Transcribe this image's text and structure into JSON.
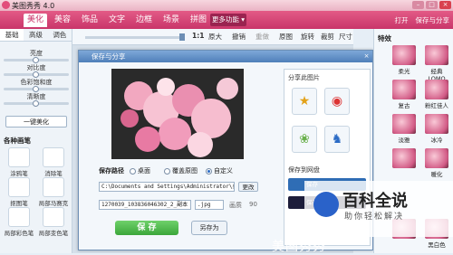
{
  "window": {
    "title": "美图秀秀 4.0"
  },
  "tabs": [
    {
      "label": "美化",
      "active": true
    },
    {
      "label": "美容",
      "active": false
    },
    {
      "label": "饰品",
      "active": false
    },
    {
      "label": "文字",
      "active": false
    },
    {
      "label": "边框",
      "active": false
    },
    {
      "label": "场景",
      "active": false
    },
    {
      "label": "拼图",
      "active": false
    }
  ],
  "more_features": "更多功能 ▾",
  "top_right": {
    "open": "打开",
    "save_share": "保存与分享"
  },
  "left": {
    "subtabs": [
      "基础",
      "高级",
      "调色"
    ],
    "sliders": [
      "亮度",
      "对比度",
      "色彩饱和度",
      "清晰度"
    ],
    "one_key": "一键美化",
    "section": "各种画笔",
    "pens": [
      "涂鸦笔",
      "消除笔",
      "抠图笔",
      "局部马赛克",
      "局部彩色笔",
      "局部变色笔"
    ]
  },
  "toolbar": {
    "zoom": "1:1",
    "original_size": "原大",
    "undo": "撤销",
    "redo": "重做",
    "original": "原图",
    "rotate": "旋转",
    "crop": "裁剪",
    "size": "尺寸"
  },
  "dialog": {
    "title": "保存与分享",
    "close": "×",
    "save_path_label": "保存路径",
    "radios": [
      {
        "label": "桌面",
        "checked": false
      },
      {
        "label": "覆盖原图",
        "checked": false
      },
      {
        "label": "自定义",
        "checked": true
      }
    ],
    "path": "C:\\Documents and Settings\\Administrator\\桌面",
    "change": "更改",
    "filename": "1270039_103836046302_2_副本",
    "format": ".jpg",
    "quality_label": "画质",
    "quality_value": "90",
    "save": "保 存",
    "save_as": "另存为",
    "share_title": "分享此图片",
    "cloud_title": "保存到网盘",
    "cloud_btn_1": "保存",
    "cloud_btn_2": "保存"
  },
  "right": {
    "title": "特效",
    "effects": [
      "柔光",
      "经典LOMO",
      "复古",
      "粉红佳人",
      "淡雅",
      "冰冷",
      "",
      "暖化",
      "",
      "黑白色"
    ]
  },
  "watermark": {
    "title": "百科全说",
    "subtitle": "助你轻松解决"
  },
  "bottom_logo": "美图秀秀"
}
